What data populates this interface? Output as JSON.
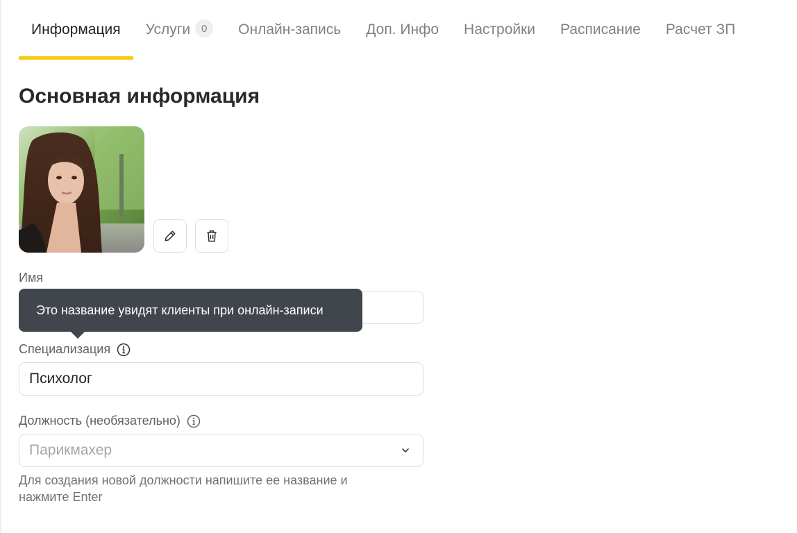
{
  "tabs": [
    {
      "label": "Информация",
      "active": true
    },
    {
      "label": "Услуги",
      "badge": "0"
    },
    {
      "label": "Онлайн-запись"
    },
    {
      "label": "Доп. Инфо"
    },
    {
      "label": "Настройки"
    },
    {
      "label": "Расписание"
    },
    {
      "label": "Расчет ЗП"
    }
  ],
  "section": {
    "title": "Основная информация"
  },
  "photo": {
    "description_icon": "profile-photo"
  },
  "actions": {
    "edit_icon": "pencil-icon",
    "delete_icon": "trash-icon"
  },
  "fields": {
    "name": {
      "label": "Имя",
      "value": ""
    },
    "specialization": {
      "label": "Специализация",
      "value": "Психолог",
      "info_icon": "info-icon"
    },
    "position": {
      "label": "Должность (необязательно)",
      "placeholder": "Парикмахер",
      "info_icon": "info-icon"
    }
  },
  "tooltip": {
    "text": "Это название увидят клиенты при онлайн-записи"
  },
  "hint": {
    "text": "Для создания новой должности напишите ее название и нажмите Enter"
  },
  "colors": {
    "accent": "#f7cc14",
    "tooltip_bg": "#40464b",
    "muted_text": "#7d8286"
  }
}
